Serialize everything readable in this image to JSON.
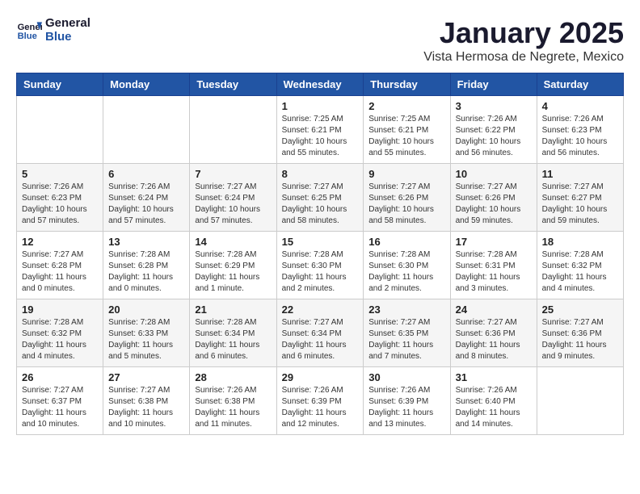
{
  "header": {
    "logo_line1": "General",
    "logo_line2": "Blue",
    "month": "January 2025",
    "location": "Vista Hermosa de Negrete, Mexico"
  },
  "weekdays": [
    "Sunday",
    "Monday",
    "Tuesday",
    "Wednesday",
    "Thursday",
    "Friday",
    "Saturday"
  ],
  "weeks": [
    [
      {
        "day": "",
        "info": ""
      },
      {
        "day": "",
        "info": ""
      },
      {
        "day": "",
        "info": ""
      },
      {
        "day": "1",
        "info": "Sunrise: 7:25 AM\nSunset: 6:21 PM\nDaylight: 10 hours\nand 55 minutes."
      },
      {
        "day": "2",
        "info": "Sunrise: 7:25 AM\nSunset: 6:21 PM\nDaylight: 10 hours\nand 55 minutes."
      },
      {
        "day": "3",
        "info": "Sunrise: 7:26 AM\nSunset: 6:22 PM\nDaylight: 10 hours\nand 56 minutes."
      },
      {
        "day": "4",
        "info": "Sunrise: 7:26 AM\nSunset: 6:23 PM\nDaylight: 10 hours\nand 56 minutes."
      }
    ],
    [
      {
        "day": "5",
        "info": "Sunrise: 7:26 AM\nSunset: 6:23 PM\nDaylight: 10 hours\nand 57 minutes."
      },
      {
        "day": "6",
        "info": "Sunrise: 7:26 AM\nSunset: 6:24 PM\nDaylight: 10 hours\nand 57 minutes."
      },
      {
        "day": "7",
        "info": "Sunrise: 7:27 AM\nSunset: 6:24 PM\nDaylight: 10 hours\nand 57 minutes."
      },
      {
        "day": "8",
        "info": "Sunrise: 7:27 AM\nSunset: 6:25 PM\nDaylight: 10 hours\nand 58 minutes."
      },
      {
        "day": "9",
        "info": "Sunrise: 7:27 AM\nSunset: 6:26 PM\nDaylight: 10 hours\nand 58 minutes."
      },
      {
        "day": "10",
        "info": "Sunrise: 7:27 AM\nSunset: 6:26 PM\nDaylight: 10 hours\nand 59 minutes."
      },
      {
        "day": "11",
        "info": "Sunrise: 7:27 AM\nSunset: 6:27 PM\nDaylight: 10 hours\nand 59 minutes."
      }
    ],
    [
      {
        "day": "12",
        "info": "Sunrise: 7:27 AM\nSunset: 6:28 PM\nDaylight: 11 hours\nand 0 minutes."
      },
      {
        "day": "13",
        "info": "Sunrise: 7:28 AM\nSunset: 6:28 PM\nDaylight: 11 hours\nand 0 minutes."
      },
      {
        "day": "14",
        "info": "Sunrise: 7:28 AM\nSunset: 6:29 PM\nDaylight: 11 hours\nand 1 minute."
      },
      {
        "day": "15",
        "info": "Sunrise: 7:28 AM\nSunset: 6:30 PM\nDaylight: 11 hours\nand 2 minutes."
      },
      {
        "day": "16",
        "info": "Sunrise: 7:28 AM\nSunset: 6:30 PM\nDaylight: 11 hours\nand 2 minutes."
      },
      {
        "day": "17",
        "info": "Sunrise: 7:28 AM\nSunset: 6:31 PM\nDaylight: 11 hours\nand 3 minutes."
      },
      {
        "day": "18",
        "info": "Sunrise: 7:28 AM\nSunset: 6:32 PM\nDaylight: 11 hours\nand 4 minutes."
      }
    ],
    [
      {
        "day": "19",
        "info": "Sunrise: 7:28 AM\nSunset: 6:32 PM\nDaylight: 11 hours\nand 4 minutes."
      },
      {
        "day": "20",
        "info": "Sunrise: 7:28 AM\nSunset: 6:33 PM\nDaylight: 11 hours\nand 5 minutes."
      },
      {
        "day": "21",
        "info": "Sunrise: 7:28 AM\nSunset: 6:34 PM\nDaylight: 11 hours\nand 6 minutes."
      },
      {
        "day": "22",
        "info": "Sunrise: 7:27 AM\nSunset: 6:34 PM\nDaylight: 11 hours\nand 6 minutes."
      },
      {
        "day": "23",
        "info": "Sunrise: 7:27 AM\nSunset: 6:35 PM\nDaylight: 11 hours\nand 7 minutes."
      },
      {
        "day": "24",
        "info": "Sunrise: 7:27 AM\nSunset: 6:36 PM\nDaylight: 11 hours\nand 8 minutes."
      },
      {
        "day": "25",
        "info": "Sunrise: 7:27 AM\nSunset: 6:36 PM\nDaylight: 11 hours\nand 9 minutes."
      }
    ],
    [
      {
        "day": "26",
        "info": "Sunrise: 7:27 AM\nSunset: 6:37 PM\nDaylight: 11 hours\nand 10 minutes."
      },
      {
        "day": "27",
        "info": "Sunrise: 7:27 AM\nSunset: 6:38 PM\nDaylight: 11 hours\nand 10 minutes."
      },
      {
        "day": "28",
        "info": "Sunrise: 7:26 AM\nSunset: 6:38 PM\nDaylight: 11 hours\nand 11 minutes."
      },
      {
        "day": "29",
        "info": "Sunrise: 7:26 AM\nSunset: 6:39 PM\nDaylight: 11 hours\nand 12 minutes."
      },
      {
        "day": "30",
        "info": "Sunrise: 7:26 AM\nSunset: 6:39 PM\nDaylight: 11 hours\nand 13 minutes."
      },
      {
        "day": "31",
        "info": "Sunrise: 7:26 AM\nSunset: 6:40 PM\nDaylight: 11 hours\nand 14 minutes."
      },
      {
        "day": "",
        "info": ""
      }
    ]
  ]
}
